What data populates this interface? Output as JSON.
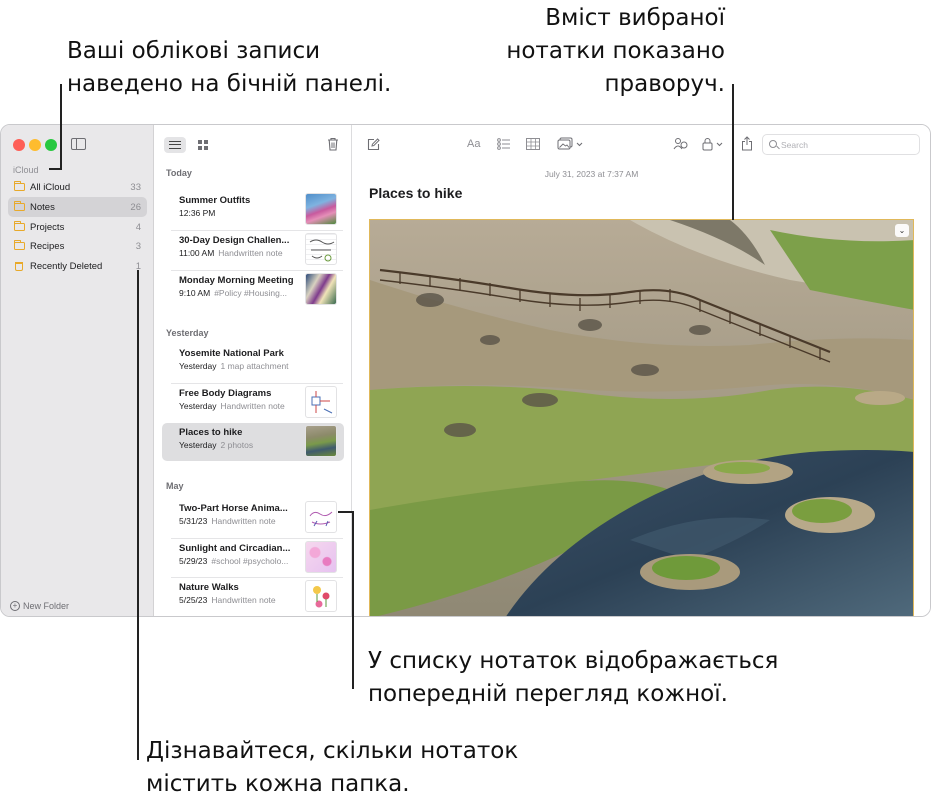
{
  "callouts": {
    "top_left": [
      "Ваші облікові записи",
      "наведено на бічній панелі."
    ],
    "top_right": [
      "Вміст вибраної",
      "нотатки показано",
      "праворуч."
    ],
    "middle": [
      "У списку нотаток відображається",
      "попередній перегляд кожної."
    ],
    "bottom": [
      "Дізнавайтеся, скільки нотаток",
      "містить кожна папка."
    ]
  },
  "sidebar": {
    "section": "iCloud",
    "folders": [
      {
        "label": "All iCloud",
        "count": "33",
        "icon": "folder-icon"
      },
      {
        "label": "Notes",
        "count": "26",
        "icon": "folder-icon",
        "selected": true
      },
      {
        "label": "Projects",
        "count": "4",
        "icon": "folder-icon"
      },
      {
        "label": "Recipes",
        "count": "3",
        "icon": "folder-icon"
      },
      {
        "label": "Recently Deleted",
        "count": "1",
        "icon": "trash-icon"
      }
    ],
    "new_folder": "New Folder"
  },
  "notes_list": {
    "groups": [
      "Today",
      "Yesterday",
      "May"
    ],
    "notes": [
      {
        "title": "Summer Outfits",
        "date": "12:36 PM",
        "preview": ""
      },
      {
        "title": "30-Day Design Challen...",
        "date": "11:00 AM",
        "preview": "Handwritten note"
      },
      {
        "title": "Monday Morning Meeting",
        "date": "9:10 AM",
        "preview": "#Policy #Housing..."
      },
      {
        "title": "Yosemite National Park",
        "date": "Yesterday",
        "preview": "1 map attachment"
      },
      {
        "title": "Free Body Diagrams",
        "date": "Yesterday",
        "preview": "Handwritten note"
      },
      {
        "title": "Places to hike",
        "date": "Yesterday",
        "preview": "2 photos",
        "selected": true
      },
      {
        "title": "Two-Part Horse Anima...",
        "date": "5/31/23",
        "preview": "Handwritten note"
      },
      {
        "title": "Sunlight and Circadian...",
        "date": "5/29/23",
        "preview": "#school #psycholo..."
      },
      {
        "title": "Nature Walks",
        "date": "5/25/23",
        "preview": "Handwritten note"
      }
    ]
  },
  "editor": {
    "toolbar": {
      "format_label": "Aa"
    },
    "search": {
      "placeholder": "Search",
      "value": ""
    },
    "date": "July 31, 2023 at 7:37 AM",
    "title": "Places to hike",
    "photo_menu": "⌄"
  },
  "colors": {
    "accent_folder": "#e8a92a",
    "sidebar_bg": "#e9e8ea",
    "selection_bg": "#dedee0"
  }
}
